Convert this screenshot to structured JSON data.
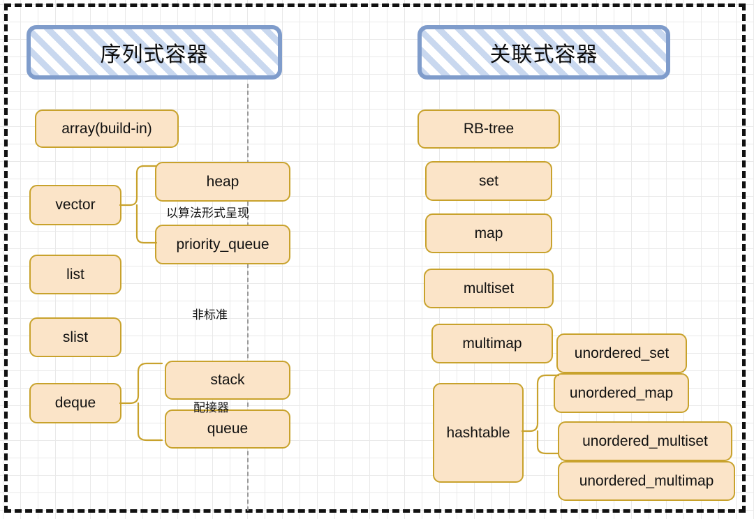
{
  "diagram": {
    "title_left": "序列式容器",
    "title_right": "关联式容器",
    "annotations": {
      "algorithm_form": "以算法形式呈现",
      "non_standard": "非标准",
      "adapter": "配接器"
    },
    "colors": {
      "node_fill": "#fbe4c8",
      "node_border": "#c8a22c",
      "banner_border": "#7f9ccb",
      "banner_hatch": "#c9d8ef",
      "frame": "#111111",
      "divider": "#9a9a9a"
    },
    "sequence_containers": [
      {
        "label": "array(build-in)"
      },
      {
        "label": "vector"
      },
      {
        "label": "heap"
      },
      {
        "label": "priority_queue"
      },
      {
        "label": "list"
      },
      {
        "label": "slist"
      },
      {
        "label": "deque"
      },
      {
        "label": "stack"
      },
      {
        "label": "queue"
      }
    ],
    "associative_containers": [
      {
        "label": "RB-tree"
      },
      {
        "label": "set"
      },
      {
        "label": "map"
      },
      {
        "label": "multiset"
      },
      {
        "label": "multimap"
      },
      {
        "label": "hashtable"
      },
      {
        "label": "unordered_set"
      },
      {
        "label": "unordered_map"
      },
      {
        "label": "unordered_multiset"
      },
      {
        "label": "unordered_multimap"
      }
    ]
  }
}
